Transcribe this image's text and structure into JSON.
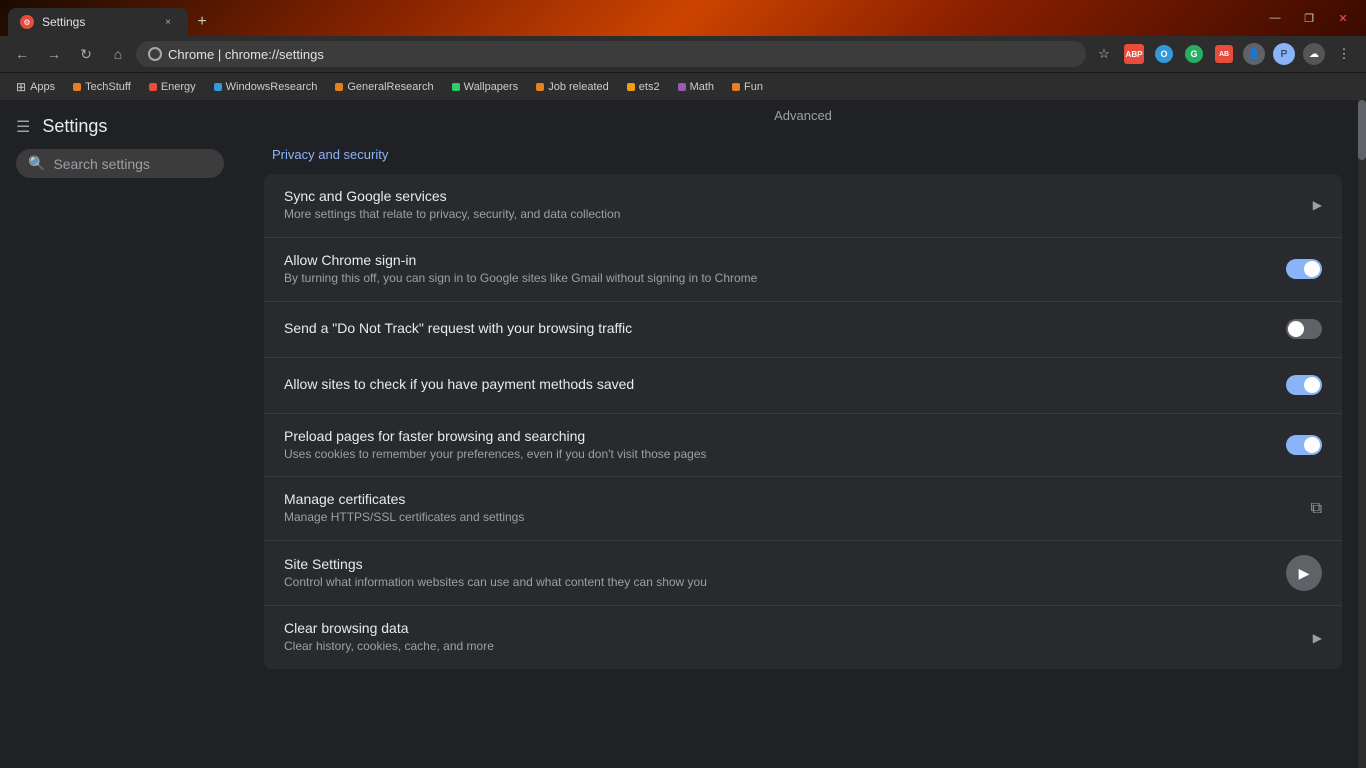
{
  "titlebar": {
    "tab_title": "Settings",
    "tab_close": "×",
    "new_tab": "+",
    "minimize": "—",
    "restore": "❐",
    "close": "✕"
  },
  "toolbar": {
    "back": "←",
    "forward": "→",
    "reload": "↻",
    "home": "⌂",
    "url_icon": "",
    "browser_name": "Chrome",
    "url": "chrome://settings",
    "url_separator": "|",
    "star": "☆",
    "menu": "⋮"
  },
  "bookmarks": [
    {
      "label": "Apps",
      "color": "#ffffff",
      "id": "apps"
    },
    {
      "label": "TechStuff",
      "color": "#e67e22",
      "id": "techstuff"
    },
    {
      "label": "Energy",
      "color": "#e74c3c",
      "id": "energy"
    },
    {
      "label": "WindowsResearch",
      "color": "#3498db",
      "id": "windowsresearch"
    },
    {
      "label": "GeneralResearch",
      "color": "#e67e22",
      "id": "generalresearch"
    },
    {
      "label": "Wallpapers",
      "color": "#2ecc71",
      "id": "wallpapers"
    },
    {
      "label": "Job releated",
      "color": "#e67e22",
      "id": "jobreleated"
    },
    {
      "label": "ets2",
      "color": "#f39c12",
      "id": "ets2"
    },
    {
      "label": "Math",
      "color": "#9b59b6",
      "id": "math"
    },
    {
      "label": "Fun",
      "color": "#e67e22",
      "id": "fun"
    }
  ],
  "sidebar": {
    "menu_label": "☰",
    "title": "Settings"
  },
  "search": {
    "placeholder": "Search settings"
  },
  "content": {
    "advanced_label": "Advanced",
    "section_title": "Privacy and security",
    "settings_rows": [
      {
        "id": "sync",
        "title": "Sync and Google services",
        "subtitle": "More settings that relate to privacy, security, and data collection",
        "control_type": "arrow",
        "control_state": "off"
      },
      {
        "id": "signin",
        "title": "Allow Chrome sign-in",
        "subtitle": "By turning this off, you can sign in to Google sites like Gmail without signing in to Chrome",
        "control_type": "toggle",
        "control_state": "on"
      },
      {
        "id": "donottrack",
        "title": "Send a \"Do Not Track\" request with your browsing traffic",
        "subtitle": "",
        "control_type": "toggle",
        "control_state": "off"
      },
      {
        "id": "paymentmethods",
        "title": "Allow sites to check if you have payment methods saved",
        "subtitle": "",
        "control_type": "toggle",
        "control_state": "on"
      },
      {
        "id": "preload",
        "title": "Preload pages for faster browsing and searching",
        "subtitle": "Uses cookies to remember your preferences, even if you don't visit those pages",
        "control_type": "toggle",
        "control_state": "on"
      },
      {
        "id": "certificates",
        "title": "Manage certificates",
        "subtitle": "Manage HTTPS/SSL certificates and settings",
        "control_type": "external",
        "control_state": "off"
      },
      {
        "id": "sitesettings",
        "title": "Site Settings",
        "subtitle": "Control what information websites can use and what content they can show you",
        "control_type": "circle_arrow",
        "control_state": "off"
      },
      {
        "id": "cleardata",
        "title": "Clear browsing data",
        "subtitle": "Clear history, cookies, cache, and more",
        "control_type": "arrow",
        "control_state": "off"
      }
    ]
  }
}
